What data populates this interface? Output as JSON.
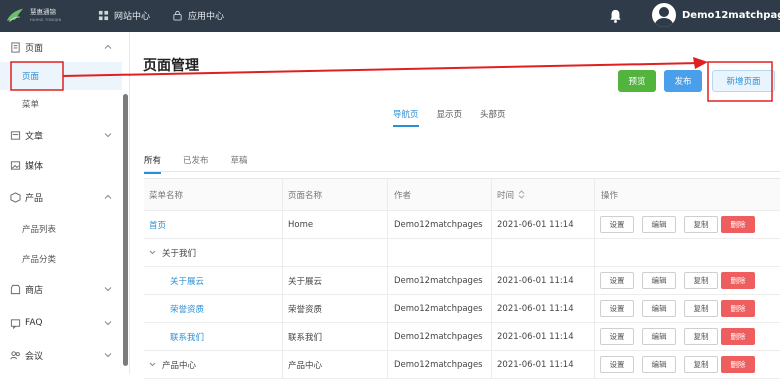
{
  "brand": {
    "name": "慧惠通锦",
    "tagline": "HUIHUI TONGJIN"
  },
  "topnav": [
    {
      "label": "网站中心",
      "icon": "grid-icon"
    },
    {
      "label": "应用中心",
      "icon": "lock-icon"
    }
  ],
  "user": {
    "name": "Demo12matchpages"
  },
  "sidebar": {
    "items": [
      {
        "label": "页面",
        "icon": "page-icon",
        "expanded": true
      },
      {
        "label": "页面",
        "active": true
      },
      {
        "label": "菜单"
      },
      {
        "label": "文章",
        "icon": "article-icon"
      },
      {
        "label": "媒体",
        "icon": "media-icon"
      },
      {
        "label": "产品",
        "icon": "product-icon",
        "expanded": true
      },
      {
        "label": "产品列表"
      },
      {
        "label": "产品分类"
      },
      {
        "label": "商店",
        "icon": "store-icon"
      },
      {
        "label": "FAQ",
        "icon": "faq-icon"
      },
      {
        "label": "会议",
        "icon": "meeting-icon"
      }
    ]
  },
  "page": {
    "title": "页面管理",
    "buttons": {
      "preview": "预览",
      "publish": "发布",
      "new_page": "新增页面"
    },
    "menu_tabs": [
      "导航页",
      "显示页",
      "头部页"
    ],
    "status_tabs": [
      "所有",
      "已发布",
      "草稿"
    ]
  },
  "table": {
    "headers": [
      "菜单名称",
      "页面名称",
      "作者",
      "时间",
      "操作"
    ],
    "actions": [
      "设置",
      "编辑",
      "复制",
      "删除"
    ],
    "rows": [
      {
        "menu": "首页",
        "page": "Home",
        "author": "Demo12matchpages",
        "time": "2021-06-01 11:14",
        "level": 0,
        "link": true,
        "group": false
      },
      {
        "menu": "关于我们",
        "page": "",
        "author": "",
        "time": "",
        "level": 0,
        "link": false,
        "group": true
      },
      {
        "menu": "关于展云",
        "page": "关于展云",
        "author": "Demo12matchpages",
        "time": "2021-06-01 11:14",
        "level": 1,
        "link": true,
        "group": false
      },
      {
        "menu": "荣誉资质",
        "page": "荣誉资质",
        "author": "Demo12matchpages",
        "time": "2021-06-01 11:14",
        "level": 1,
        "link": true,
        "group": false
      },
      {
        "menu": "联系我们",
        "page": "联系我们",
        "author": "Demo12matchpages",
        "time": "2021-06-01 11:14",
        "level": 1,
        "link": true,
        "group": false
      },
      {
        "menu": "产品中心",
        "page": "产品中心",
        "author": "Demo12matchpages",
        "time": "2021-06-01 11:14",
        "level": 0,
        "link": false,
        "group": true
      }
    ]
  },
  "colors": {
    "topbar": "#2f3b48",
    "accent": "#2b8fd6",
    "preview": "#52b43d",
    "publish": "#4a9fea",
    "delete": "#ee5e5e",
    "annotation": "#e02020"
  }
}
